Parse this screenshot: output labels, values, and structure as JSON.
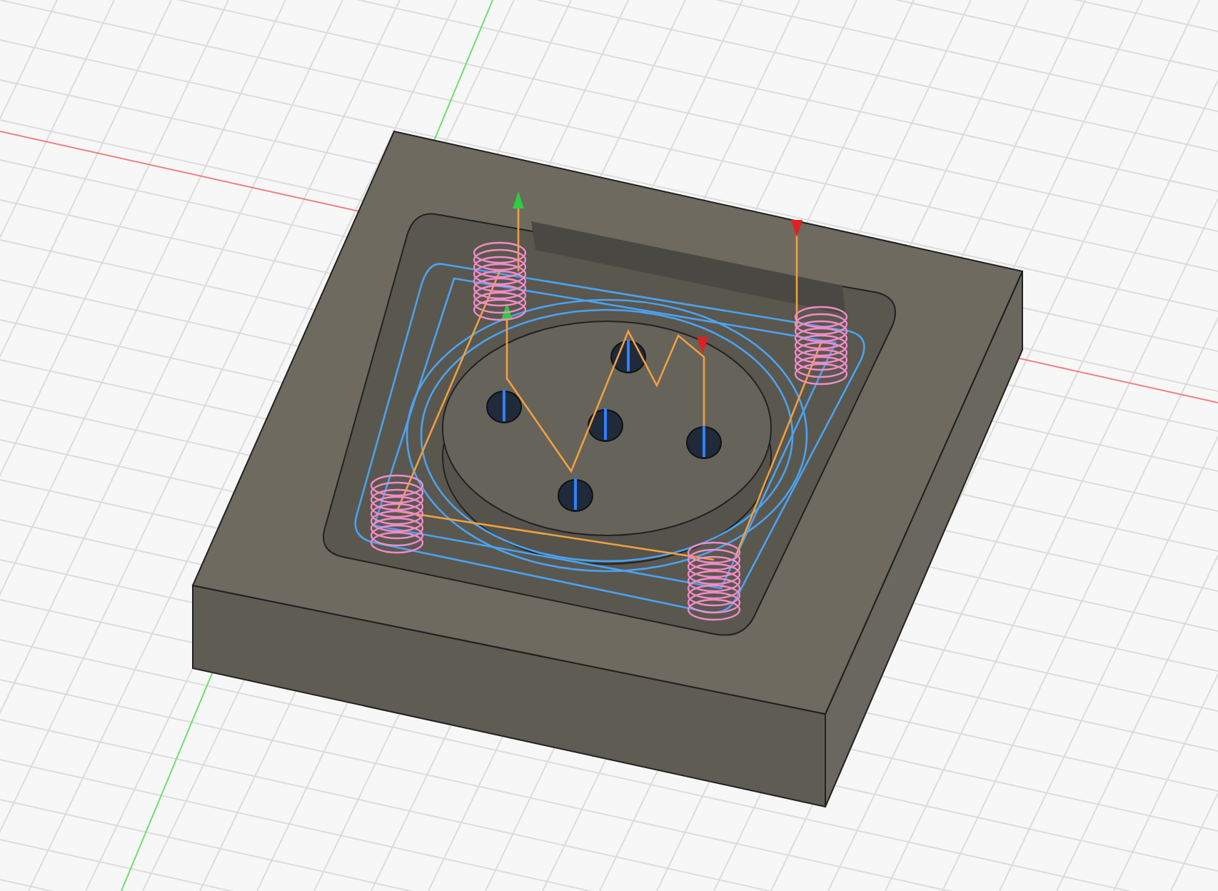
{
  "viewport": {
    "kind": "pocket-block",
    "show_toolpaths": true
  }
}
